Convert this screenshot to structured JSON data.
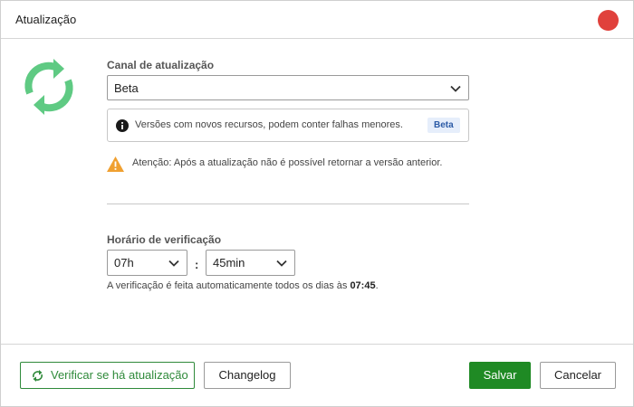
{
  "dialog": {
    "title": "Atualização",
    "close_color": "#e0413c"
  },
  "update_channel": {
    "label": "Canal de atualização",
    "selected": "Beta",
    "info_icon": "info-icon",
    "info_text": "Versões com novos recursos, podem conter falhas menores.",
    "badge": "Beta",
    "warning_icon": "warning-triangle-icon",
    "warning_text": "Atenção: Após a atualização não é possível retornar a versão anterior."
  },
  "check_time": {
    "label": "Horário de verificação",
    "hour": "07h",
    "separator": ":",
    "minute": "45min",
    "hint_prefix": "A verificação é feita automaticamente todos os dias às ",
    "hint_time": "07:45",
    "hint_suffix": "."
  },
  "buttons": {
    "check_updates": "Verificar se há atualização",
    "changelog": "Changelog",
    "save": "Salvar",
    "cancel": "Cancelar"
  },
  "colors": {
    "accent_green": "#1f8a24",
    "sync_icon": "#5fca83",
    "badge_bg": "#e6eefb",
    "warning": "#f0a030"
  }
}
